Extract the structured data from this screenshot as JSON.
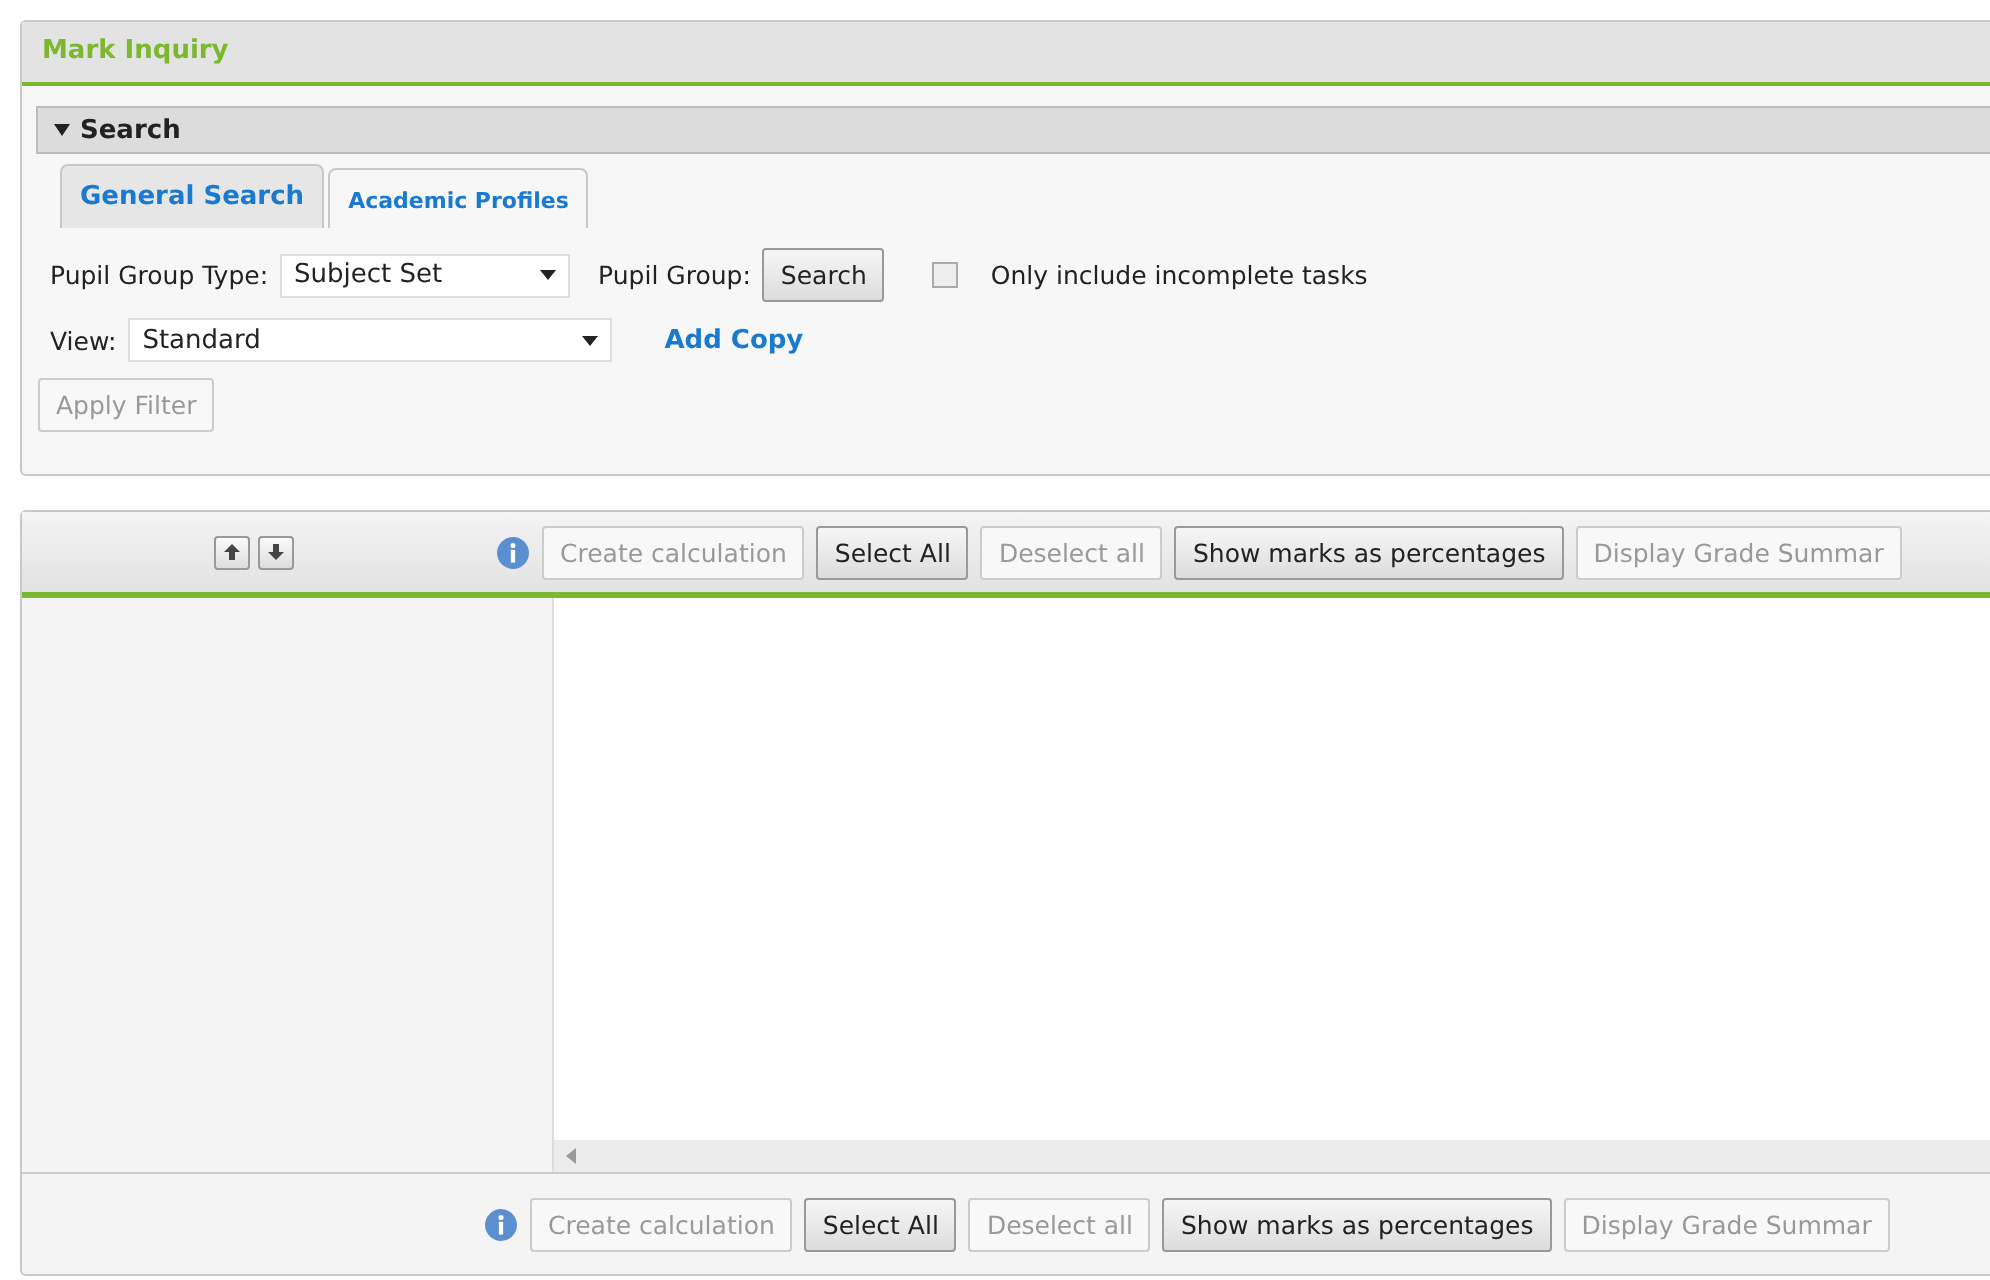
{
  "page": {
    "title": "Mark Inquiry"
  },
  "search": {
    "title": "Search",
    "expanded": true,
    "tabs": [
      {
        "label": "General Search",
        "selected": true
      },
      {
        "label": "Academic Profiles",
        "selected": false
      }
    ],
    "pupil_group_type": {
      "label": "Pupil Group Type:",
      "value": "Subject Set"
    },
    "pupil_group": {
      "label": "Pupil Group:",
      "button": "Search"
    },
    "incomplete_tasks": {
      "label": "Only include incomplete tasks",
      "checked": false
    },
    "view": {
      "label": "View:",
      "value": "Standard",
      "link": "Add Copy"
    },
    "apply": {
      "label": "Apply Filter",
      "disabled": true
    }
  },
  "toolbar_top": [
    {
      "label": "Create calculation",
      "disabled": true
    },
    {
      "label": "Select All",
      "disabled": false
    },
    {
      "label": "Deselect all",
      "disabled": true
    },
    {
      "label": "Show marks as percentages",
      "disabled": false
    },
    {
      "label": "Display Grade Summar",
      "disabled": true
    }
  ],
  "toolbar_bottom": [
    {
      "label": "Create calculation",
      "disabled": true
    },
    {
      "label": "Select All",
      "disabled": false
    },
    {
      "label": "Deselect all",
      "disabled": true
    },
    {
      "label": "Show marks as percentages",
      "disabled": false
    },
    {
      "label": "Display Grade Summar",
      "disabled": true
    }
  ]
}
